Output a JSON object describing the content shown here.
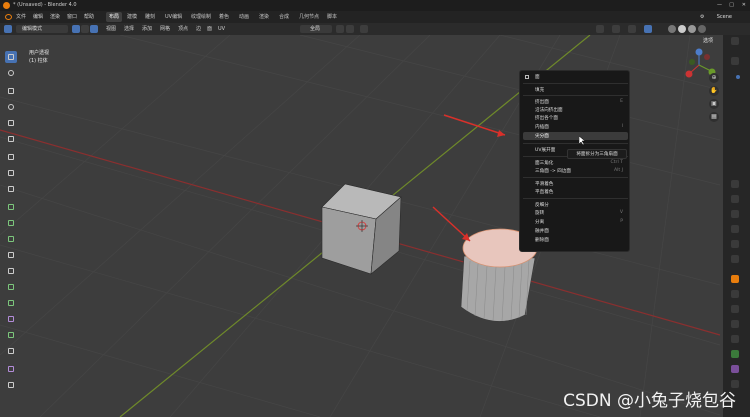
{
  "window": {
    "title": "* (Unsaved) - Blender 4.0"
  },
  "menu": [
    "文件",
    "编辑",
    "渲染",
    "窗口",
    "帮助"
  ],
  "workspaces": [
    {
      "label": "布局",
      "active": true
    },
    {
      "label": "建模",
      "active": false
    },
    {
      "label": "雕刻",
      "active": false
    },
    {
      "label": "UV编辑",
      "active": false
    },
    {
      "label": "纹理绘制",
      "active": false
    },
    {
      "label": "着色",
      "active": false
    },
    {
      "label": "动画",
      "active": false
    },
    {
      "label": "渲染",
      "active": false
    },
    {
      "label": "合成",
      "active": false
    },
    {
      "label": "几何节点",
      "active": false
    },
    {
      "label": "脚本",
      "active": false
    }
  ],
  "scene_label": "Scene",
  "header": {
    "mode": "编辑模式",
    "menus": [
      "视图",
      "选择",
      "添加",
      "网格",
      "顶点",
      "边",
      "面",
      "UV"
    ],
    "transform_orientation": "全局",
    "options_label": "选项"
  },
  "viewport": {
    "view_name": "用户透视",
    "object_name": "(1) 柱体"
  },
  "context_menu": {
    "title": "面",
    "items": [
      {
        "label": "填充",
        "shortcut": ""
      },
      {
        "label": "挤出面",
        "shortcut": "E"
      },
      {
        "label": "沿法向挤出面",
        "shortcut": ""
      },
      {
        "label": "挤出各个面",
        "shortcut": ""
      },
      {
        "label": "内插面",
        "shortcut": "I"
      },
      {
        "label": "尖分面",
        "shortcut": "",
        "highlighted": true
      },
      {
        "label": "UV展开面",
        "shortcut": ""
      },
      {
        "label": "面三角化",
        "shortcut": "Ctrl T"
      },
      {
        "label": "三角面 -> 四边面",
        "shortcut": "Alt J"
      },
      {
        "label": "平滑着色",
        "shortcut": ""
      },
      {
        "label": "平直着色",
        "shortcut": ""
      },
      {
        "label": "反细分",
        "shortcut": ""
      },
      {
        "label": "旋转",
        "shortcut": "V"
      },
      {
        "label": "分离",
        "shortcut": "P"
      },
      {
        "label": "融并面",
        "shortcut": ""
      },
      {
        "label": "删除面",
        "shortcut": ""
      }
    ],
    "tooltip": "将面拆分为三角扇面"
  },
  "watermark": "CSDN @小兔子烧包谷",
  "colors": {
    "accent": "#4772b3",
    "orange": "#e87d0d",
    "axis_x": "#c0392b",
    "axis_y": "#7a9a2a",
    "arrow": "#d9302a"
  },
  "icons": {
    "blender_logo": "blender-logo-icon",
    "nav": [
      "zoom-icon",
      "pan-hand-icon",
      "camera-icon",
      "grid-view-icon"
    ]
  }
}
